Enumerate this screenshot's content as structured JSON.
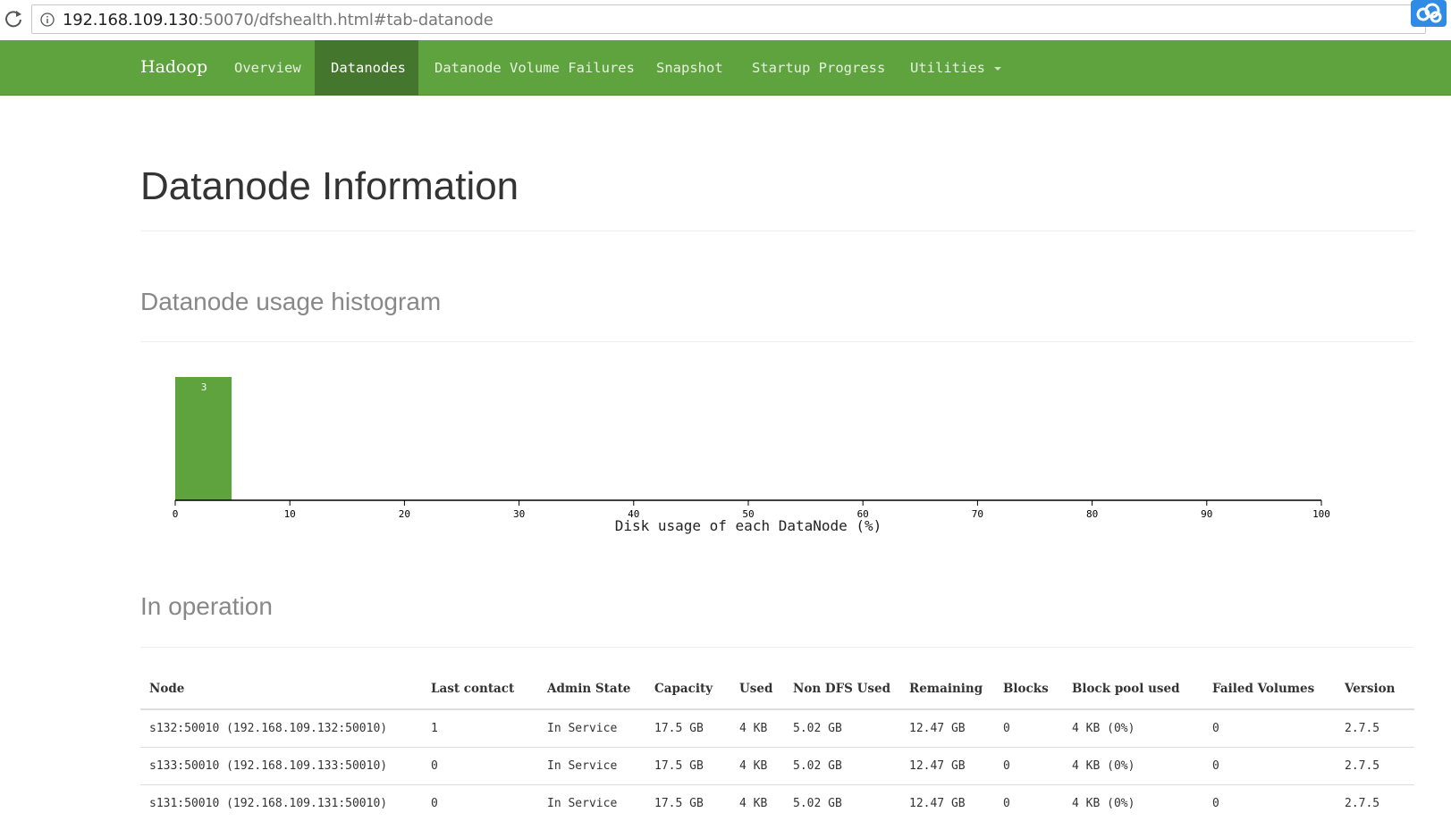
{
  "browser": {
    "url_host": "192.168.109.130",
    "url_rest": ":50070/dfshealth.html#tab-datanode"
  },
  "navbar": {
    "brand": "Hadoop",
    "items": [
      {
        "label": "Overview",
        "active": false
      },
      {
        "label": "Datanodes",
        "active": true
      },
      {
        "label": "Datanode Volume Failures",
        "active": false
      },
      {
        "label": "Snapshot",
        "active": false
      },
      {
        "label": "Startup Progress",
        "active": false
      },
      {
        "label": "Utilities",
        "active": false
      }
    ]
  },
  "page": {
    "title": "Datanode Information",
    "histogram_title": "Datanode usage histogram",
    "operation_title": "In operation"
  },
  "chart_data": {
    "type": "bar",
    "xlabel": "Disk usage of each DataNode (%)",
    "xlim": [
      0,
      100
    ],
    "xticks": [
      0,
      10,
      20,
      30,
      40,
      50,
      60,
      70,
      80,
      90,
      100
    ],
    "bins": [
      {
        "x0": 0,
        "x1": 5,
        "count": 3
      }
    ],
    "bar_color": "#5fa33e"
  },
  "table": {
    "headers": [
      "Node",
      "Last contact",
      "Admin State",
      "Capacity",
      "Used",
      "Non DFS Used",
      "Remaining",
      "Blocks",
      "Block pool used",
      "Failed Volumes",
      "Version"
    ],
    "rows": [
      [
        "s132:50010 (192.168.109.132:50010)",
        "1",
        "In Service",
        "17.5 GB",
        "4 KB",
        "5.02 GB",
        "12.47 GB",
        "0",
        "4 KB (0%)",
        "0",
        "2.7.5"
      ],
      [
        "s133:50010 (192.168.109.133:50010)",
        "0",
        "In Service",
        "17.5 GB",
        "4 KB",
        "5.02 GB",
        "12.47 GB",
        "0",
        "4 KB (0%)",
        "0",
        "2.7.5"
      ],
      [
        "s131:50010 (192.168.109.131:50010)",
        "0",
        "In Service",
        "17.5 GB",
        "4 KB",
        "5.02 GB",
        "12.47 GB",
        "0",
        "4 KB (0%)",
        "0",
        "2.7.5"
      ]
    ]
  }
}
